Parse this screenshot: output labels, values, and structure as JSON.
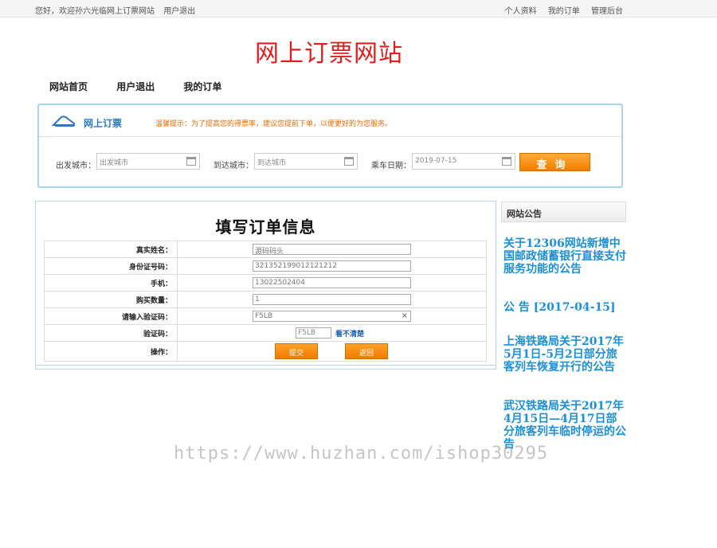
{
  "topbar": {
    "greeting": "您好，欢迎孙六光临网上订票网站",
    "logout": "用户退出",
    "links": [
      "个人资料",
      "我的订单",
      "管理后台"
    ]
  },
  "site_title": "网上订票网站",
  "nav": [
    "网站首页",
    "用户退出",
    "我的订单"
  ],
  "ticket": {
    "title": "网上订票",
    "tip": "温馨提示：为了提高您的得票率，建议您提前下单，以便更好的为您服务。",
    "depart_label": "出发城市：",
    "depart_placeholder": "出发城市",
    "arrive_label": "到达城市：",
    "arrive_placeholder": "到达城市",
    "date_label": "乘车日期：",
    "date_value": "2019-07-15",
    "query_button": "查询"
  },
  "order": {
    "title": "填写订单信息",
    "rows": [
      {
        "label": "真实姓名：",
        "value": "源码码头"
      },
      {
        "label": "身份证号码：",
        "value": "321352199012121212"
      },
      {
        "label": "手机：",
        "value": "13022502404"
      },
      {
        "label": "购买数量：",
        "value": "1"
      },
      {
        "label": "请输入验证码：",
        "value": "F5LB"
      }
    ],
    "captcha_label": "验证码：",
    "captcha_value": "F5LB",
    "captcha_refresh": "看不清楚",
    "action_label": "操作：",
    "submit": "提交",
    "back": "返回"
  },
  "sidebar": {
    "heading": "网站公告",
    "notices": [
      "关于12306网站新增中国邮政储蓄银行直接支付服务功能的公告",
      "公 告 [2017-04-15]",
      "上海铁路局关于2017年5月1日-5月2日部分旅客列车恢复开行的公告",
      "武汉铁路局关于2017年4月15日—4月17日部分旅客列车临时停运的公告"
    ]
  },
  "watermark": "https://www.huzhan.com/ishop30295",
  "colors": {
    "title_red": "#e61d1d",
    "notice_blue": "#1b8fd8",
    "button_orange": "#f07e00",
    "tip_orange": "#f06a00"
  }
}
